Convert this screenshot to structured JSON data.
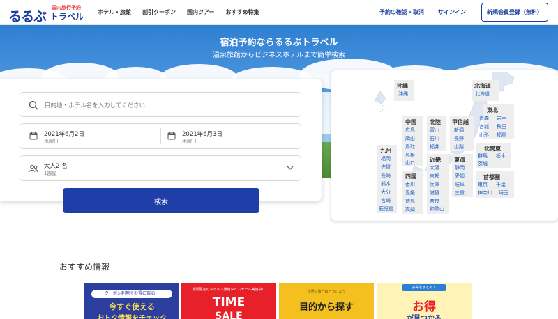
{
  "header": {
    "logo_main": "るるぶ",
    "logo_sub": "国内旅行予約",
    "logo_travel": "トラベル",
    "nav": [
      "ホテル・旅館",
      "割引クーポン",
      "国内ツアー",
      "おすすめ特集"
    ],
    "reservation_link": "予約の確認・取消",
    "signin_link": "サインイン",
    "signup_button": "新規会員登録（無料）"
  },
  "hero": {
    "title": "宿泊予約ならるるぶトラベル",
    "subtitle": "温泉旅館からビジネスホテルまで簡単検索"
  },
  "search": {
    "destination_placeholder": "目的地・ホテル名を入力してください",
    "checkin_date": "2021年6月2日",
    "checkin_day": "水曜日",
    "checkout_date": "2021年6月3日",
    "checkout_day": "木曜日",
    "guests": "大人2 名",
    "rooms": "1部屋",
    "button": "検索"
  },
  "map": {
    "regions": {
      "okinawa": {
        "title": "沖縄",
        "prefs": [
          "沖縄"
        ]
      },
      "hokkaido": {
        "title": "北海道",
        "prefs": [
          "北海道"
        ]
      },
      "tohoku": {
        "title": "東北",
        "prefs": [
          "青森",
          "岩手",
          "宮城",
          "秋田",
          "山形",
          "福島"
        ]
      },
      "chugoku": {
        "title": "中国",
        "prefs": [
          "広島",
          "岡山",
          "鳥取",
          "島根",
          "山口"
        ]
      },
      "hokuriku": {
        "title": "北陸",
        "prefs": [
          "富山",
          "石川",
          "福井"
        ]
      },
      "koshinetsu": {
        "title": "甲信越",
        "prefs": [
          "新潟",
          "長野",
          "山梨"
        ]
      },
      "kanto": {
        "title": "北関東",
        "prefs": [
          "群馬",
          "栃木",
          "茨城"
        ]
      },
      "kyushu": {
        "title": "九州",
        "prefs": [
          "福岡",
          "佐賀",
          "長崎",
          "熊本",
          "大分",
          "宮崎",
          "鹿児島"
        ]
      },
      "shikoku": {
        "title": "四国",
        "prefs": [
          "香川",
          "愛媛",
          "徳島",
          "高知"
        ]
      },
      "kinki": {
        "title": "近畿",
        "prefs": [
          "大阪",
          "京都",
          "兵庫",
          "滋賀",
          "奈良",
          "和歌山"
        ]
      },
      "tokai": {
        "title": "東海",
        "prefs": [
          "静岡",
          "愛知",
          "岐阜",
          "三重"
        ]
      },
      "shutoken": {
        "title": "首都圏",
        "prefs": [
          "東京",
          "千葉",
          "神奈川",
          "埼玉"
        ]
      }
    }
  },
  "recommend": {
    "title": "おすすめ情報",
    "banners": [
      {
        "top": "クーポン利用でお得に宿泊！",
        "main": "今すぐ使える",
        "sub": "おトク情報をチェック"
      },
      {
        "top": "期間限定のホテル・旅館タイムセール実施中！",
        "main": "TIME",
        "sub": "SALE"
      },
      {
        "top": "今回の旅行はどうしよう",
        "main": "目的から探す"
      },
      {
        "top": "お得をまとめて",
        "main": "お得",
        "sub": "が見つかる"
      }
    ]
  },
  "colors": {
    "brand": "#1a3e9c",
    "accent": "#1f3fa8",
    "pref_link": "#1a5fc8"
  }
}
